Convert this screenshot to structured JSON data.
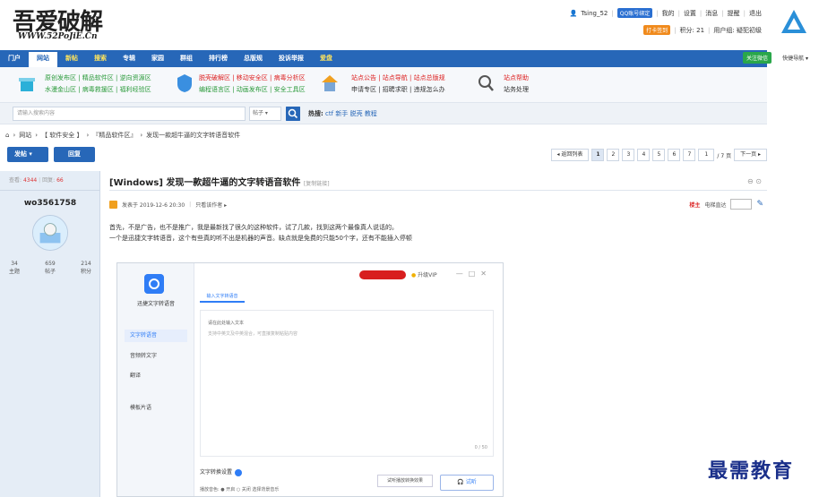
{
  "logo": {
    "main": "吾爱破解",
    "url": "WWW.52PoJiE.Cn"
  },
  "userbar": {
    "username": "Tsing_52",
    "qq_badge": "QQ账号绑定",
    "links": [
      "我的",
      "设置",
      "消息",
      "提醒",
      "退出"
    ],
    "checkin": "打卡签到",
    "points": "积分: 21",
    "group": "用户组: 疑犯初级"
  },
  "nav": {
    "items": [
      {
        "label": "门户",
        "style": "normal"
      },
      {
        "label": "网站",
        "style": "active"
      },
      {
        "label": "新帖",
        "style": "yellow"
      },
      {
        "label": "搜索",
        "style": "yellow"
      },
      {
        "label": "专辑",
        "style": "normal"
      },
      {
        "label": "家园",
        "style": "normal"
      },
      {
        "label": "群组",
        "style": "normal"
      },
      {
        "label": "排行榜",
        "style": "normal"
      },
      {
        "label": "总版规",
        "style": "normal"
      },
      {
        "label": "投诉举报",
        "style": "normal"
      },
      {
        "label": "爱盘",
        "style": "yellow"
      }
    ],
    "follow": "关注微信",
    "quick": "快捷导航"
  },
  "subnav": {
    "g1": [
      "原创发布区 | 精品软件区 | 逆向资源区",
      "水漫金山区 | 病毒救援区 | 福利经验区"
    ],
    "g2": [
      "脱壳破解区 | 移动安全区 | 病毒分析区",
      "编程语言区 | 动画发布区 | 安全工具区"
    ],
    "g3": [
      "站点公告 | 站点导航 | 站点总版规",
      "申请专区 | 招聘求职 | 违规怎么办"
    ],
    "g4": [
      "站点帮助",
      "站务处理"
    ]
  },
  "search": {
    "placeholder": "请输入搜索内容",
    "type": "帖子",
    "hot_label": "热搜:",
    "hot": [
      "ctf",
      "新手",
      "脱壳",
      "教程"
    ]
  },
  "breadcrumb": {
    "items": [
      "网站",
      "【 软件安全 】",
      "『精品软件区』",
      "发现一款超牛逼的文字转语音软件"
    ]
  },
  "actions": {
    "post": "发帖",
    "reply": "回复"
  },
  "pager": {
    "back": "◂ 返回列表",
    "pages": [
      "1",
      "2",
      "3",
      "4",
      "5",
      "6",
      "7"
    ],
    "current": "1",
    "total": "/ 7 页",
    "next": "下一页 ▸"
  },
  "thread": {
    "views_label": "查看:",
    "views": "4344",
    "replies_label": "回复:",
    "replies": "66",
    "title": "[Windows] 发现一款超牛逼的文字转语音软件",
    "copy_link": "[复制链接]",
    "author": "wo3561758",
    "user_stats": [
      {
        "value": "34",
        "label": "主题"
      },
      {
        "value": "659",
        "label": "帖子"
      },
      {
        "value": "214",
        "label": "积分"
      }
    ],
    "posted": "发表于 2019-12-6 20:30",
    "only_author": "只看该作者 ▸",
    "floor": "楼主",
    "jump": "电梯直达",
    "body": [
      "首先，不是广告，也不是推广，我是最新找了很久的这种软件，试了几款，找到这两个最像真人说话的。",
      "一个是迅捷文字转语音，这个有些真的听不出是机器的声音。缺点就是免费的只能50个字，还有不能插入停顿"
    ]
  },
  "screenshot": {
    "app_name": "迅捷文字转语音",
    "menu": [
      "文字转语音",
      "音频转文字",
      "翻译",
      "模板片语"
    ],
    "vip": "升级VIP",
    "tab": "输入文字转语音",
    "input_title": "请在此处输入文本",
    "input_hint": "支持中英文及中英混合，可直接复制粘贴内容",
    "count": "0 / 50",
    "settings": "文字转换设置",
    "listen": "试听播放转换效果",
    "try": "试听",
    "row2": "播放音色:  ● 开启   ○ 关闭      选择背景音乐"
  },
  "watermark": "最需教育"
}
